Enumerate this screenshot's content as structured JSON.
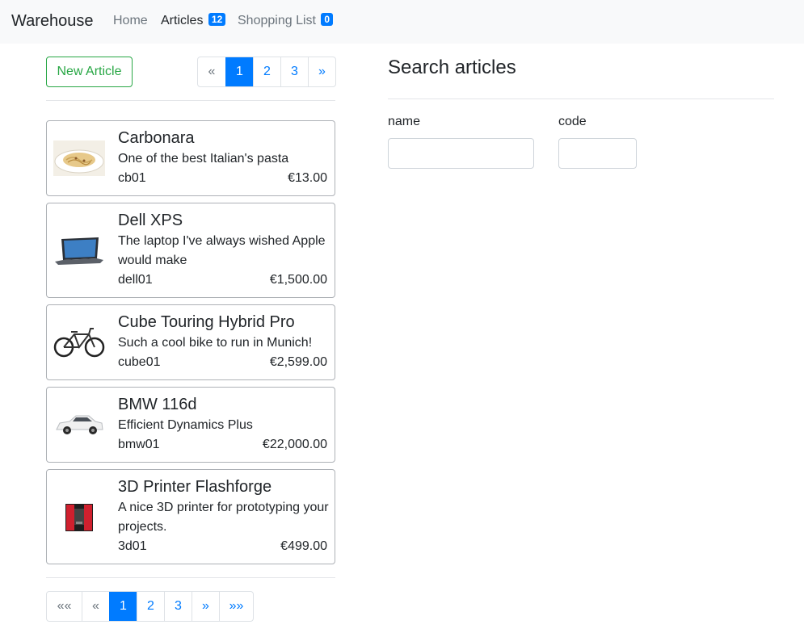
{
  "navbar": {
    "brand": "Warehouse",
    "links": [
      {
        "label": "Home"
      },
      {
        "label": "Articles",
        "badge": "12"
      },
      {
        "label": "Shopping List",
        "badge": "0"
      }
    ]
  },
  "toolbar": {
    "new_article_label": "New Article"
  },
  "pagination_top": [
    "«",
    "1",
    "2",
    "3",
    "»"
  ],
  "pagination_bottom": [
    "««",
    "«",
    "1",
    "2",
    "3",
    "»",
    "»»"
  ],
  "articles": [
    {
      "title": "Carbonara",
      "description": "One of the best Italian's pasta",
      "code": "cb01",
      "price": "€13.00",
      "icon": "pasta-image"
    },
    {
      "title": "Dell XPS",
      "description": "The laptop I've always wished Apple would make",
      "code": "dell01",
      "price": "€1,500.00",
      "icon": "laptop-image"
    },
    {
      "title": "Cube Touring Hybrid Pro",
      "description": "Such a cool bike to run in Munich!",
      "code": "cube01",
      "price": "€2,599.00",
      "icon": "bike-image"
    },
    {
      "title": "BMW 116d",
      "description": "Efficient Dynamics Plus",
      "code": "bmw01",
      "price": "€22,000.00",
      "icon": "car-image"
    },
    {
      "title": "3D Printer Flashforge",
      "description": "A nice 3D printer for prototyping your projects.",
      "code": "3d01",
      "price": "€499.00",
      "icon": "printer-image"
    }
  ],
  "search": {
    "title": "Search articles",
    "name_label": "name",
    "code_label": "code",
    "name_value": "",
    "code_value": ""
  },
  "colors": {
    "primary": "#007bff",
    "success": "#28a745",
    "navbar_bg": "#f8f9fa"
  }
}
